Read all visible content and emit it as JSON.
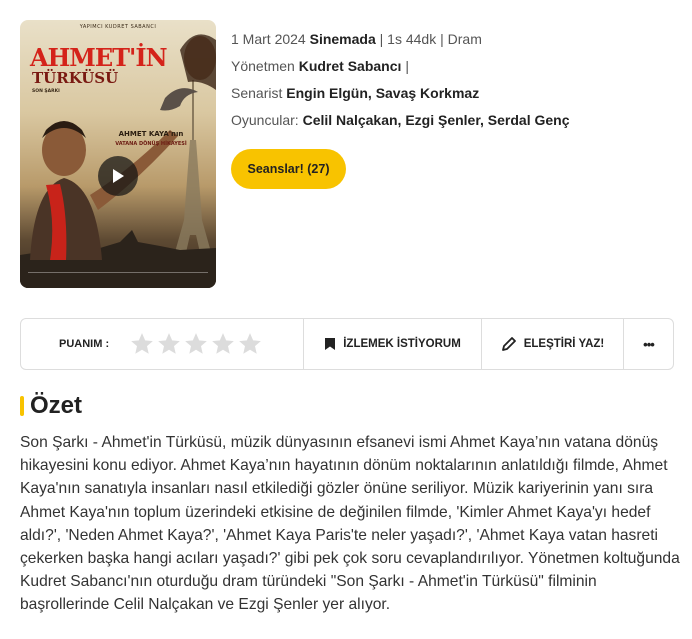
{
  "poster": {
    "producer_line": "YAPIMCI KUDRET SABANCI",
    "title_main": "AHMET'İN",
    "title_sub": "TÜRKÜSÜ",
    "small_text": "SON ŞARKI",
    "cast_name": "AHMET KAYA'nın",
    "cast_sub": "VATANA DÖNÜŞ HİKAYESİ"
  },
  "film": {
    "date": "1 Mart 2024",
    "status": "Sinemada",
    "sep1": "|",
    "duration": "1s 44dk",
    "sep2": "|",
    "genre": "Dram",
    "director_label": "Yönetmen",
    "director": "Kudret Sabancı",
    "director_sep": "|",
    "writer_label": "Senarist",
    "writers": [
      "Engin Elgün",
      "Savaş Korkmaz"
    ],
    "cast_label": "Oyuncular:",
    "cast": [
      "Celil Nalçakan",
      "Ezgi Şenler",
      "Serdal Genç"
    ],
    "comma": ","
  },
  "seans_button": "Seanslar! (27)",
  "action_bar": {
    "rating_label": "PUANIM :",
    "star_color_empty": "#dcdcdc",
    "watchlist_label": "İZLEMEK İSTİYORUM",
    "review_label": "ELEŞTİRİ YAZ!",
    "more_label": "•••"
  },
  "summary": {
    "title": "Özet",
    "text": "Son Şarkı - Ahmet'in Türküsü, müzik dünyasının efsanevi ismi Ahmet Kaya’nın vatana dönüş hikayesini konu ediyor. Ahmet Kaya’nın hayatının dönüm noktalarının anlatıldığı filmde, Ahmet Kaya'nın sanatıyla insanları nasıl etkilediği gözler önüne seriliyor. Müzik kariyerinin yanı sıra Ahmet Kaya'nın toplum üzerindeki etkisine de değinilen filmde, 'Kimler Ahmet Kaya'yı hedef aldı?', 'Neden Ahmet Kaya?', 'Ahmet Kaya Paris'te neler yaşadı?', 'Ahmet Kaya vatan hasreti çekerken başka hangi acıları yaşadı?' gibi pek çok soru cevaplandırılıyor. Yönetmen koltuğunda Kudret Sabancı'nın oturduğu dram türündeki \"Son Şarkı - Ahmet'in Türküsü\" filminin başrollerinde Celil Nalçakan ve Ezgi Şenler yer alıyor."
  },
  "colors": {
    "accent": "#f8c300",
    "poster_red": "#d4231a"
  }
}
